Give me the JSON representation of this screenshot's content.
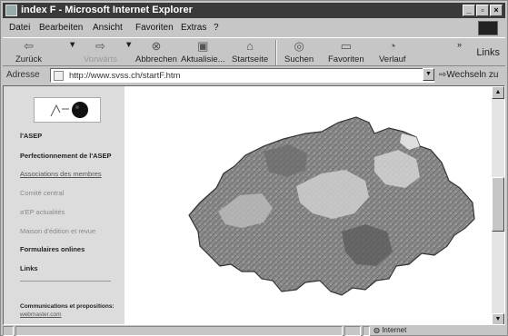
{
  "window": {
    "title": "index F - Microsoft Internet Explorer"
  },
  "menu": {
    "items": [
      "Datei",
      "Bearbeiten",
      "Ansicht",
      "Favoriten",
      "Extras",
      "?"
    ]
  },
  "toolbar": {
    "back": "Zurück",
    "forward": "Vorwärts",
    "stop": "Abbrechen",
    "refresh": "Aktualisie...",
    "home": "Startseite",
    "search": "Suchen",
    "favorites": "Favoriten",
    "history": "Verlauf",
    "links": "Links"
  },
  "address": {
    "label": "Adresse",
    "url": "http://www.svss.ch/startF.htm",
    "go": "Wechseln zu"
  },
  "sidebar": {
    "nav": [
      "l'ASEP",
      "Perfectionnement de l'ASEP",
      "Associations des membres",
      "Comité central",
      "a'EP actualités",
      "Maison d'édition et revue",
      "Formulaires onlines",
      "Links"
    ],
    "footer": "Communications et propositions:",
    "footer_mail": "webmaster.com"
  },
  "status": {
    "zone": "Internet"
  }
}
